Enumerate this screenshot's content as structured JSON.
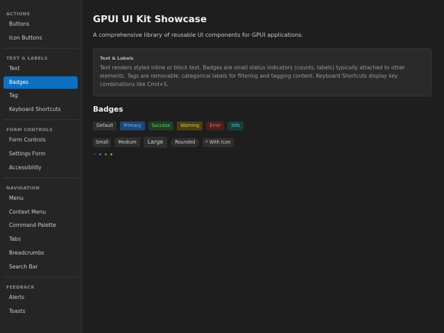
{
  "sidebar": {
    "sections": [
      {
        "title": "ACTIONS",
        "items": [
          "Buttons",
          "Icon Buttons"
        ]
      },
      {
        "title": "TEXT & LABELS",
        "items": [
          "Text",
          "Badges",
          "Tag",
          "Keyboard Shortcuts"
        ]
      },
      {
        "title": "FORM CONTROLS",
        "items": [
          "Form Controls",
          "Settings Form",
          "Accessibility"
        ]
      },
      {
        "title": "NAVIGATION",
        "items": [
          "Menu",
          "Context Menu",
          "Command Palette",
          "Tabs",
          "Breadcrumbs",
          "Search Bar"
        ]
      },
      {
        "title": "FEEDBACK",
        "items": [
          "Alerts",
          "Toasts"
        ]
      }
    ],
    "active_item": "Badges"
  },
  "main": {
    "title": "GPUI UI Kit Showcase",
    "subtitle": "A comprehensive library of reusable UI components for GPUI applications.",
    "info_card": {
      "title": "Text & Labels",
      "text": "Text renders styled inline or block text. Badges are small status indicators (counts, labels) typically attached to other elements. Tags are removable, categorical labels for filtering and tagging content. Keyboard Shortcuts display key combinations like Cmd+S."
    },
    "section_title": "Badges",
    "variant_badges": [
      "Default",
      "Primary",
      "Success",
      "Warning",
      "Error",
      "Info"
    ],
    "size_badges": [
      "Small",
      "Medium",
      "Large",
      "Rounded",
      "With Icon"
    ],
    "with_icon_glyph": "*",
    "dots": [
      "#3a3a3a",
      "#2f7fd0",
      "#3ca04a",
      "#b89a2a"
    ]
  },
  "colors": {
    "accent": "#0e70c0",
    "background": "#1e1e1e",
    "sidebar": "#252526"
  }
}
